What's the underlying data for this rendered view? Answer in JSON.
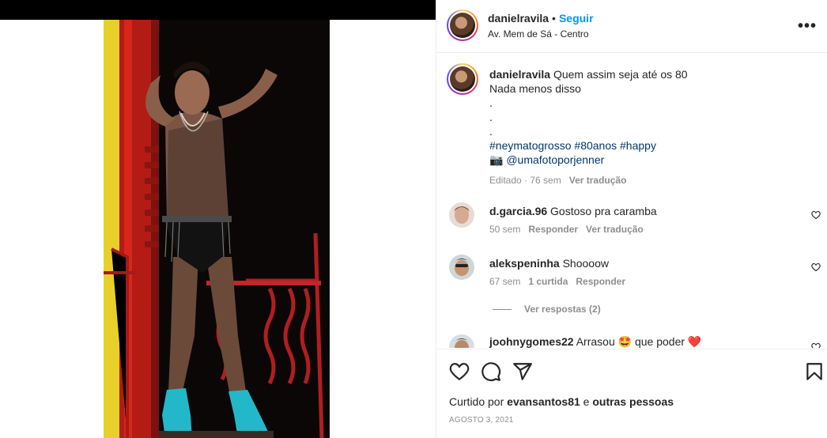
{
  "post": {
    "username": "danielravila",
    "follow_label": "Seguir",
    "location": "Av. Mem de Sá - Centro",
    "more_label": "•••"
  },
  "caption": {
    "username": "danielravila",
    "line1": "Quem assim seja até os 80",
    "line2": "Nada menos disso",
    "dot1": ".",
    "dot2": ".",
    "dot3": ".",
    "hashtags": [
      "#neymatogrosso",
      "#80anos",
      "#happy"
    ],
    "camera_emoji": "📷",
    "mention": "@umafotoporjenner",
    "edited": "Editado",
    "time": "76 sem",
    "translate": "Ver tradução"
  },
  "comments": [
    {
      "username": "d.garcia.96",
      "text": "Gostoso pra caramba",
      "time": "50 sem",
      "reply_label": "Responder",
      "translate_label": "Ver tradução"
    },
    {
      "username": "alekspeninha",
      "text": "Shoooow",
      "time": "67 sem",
      "likes_label": "1 curtida",
      "reply_label": "Responder",
      "view_replies": "Ver respostas (2)"
    },
    {
      "username": "joohnygomes22",
      "text_before": "Arrasou",
      "emoji1": "🤩",
      "text_after": "que poder",
      "emoji2": "❤️"
    }
  ],
  "footer": {
    "liked_prefix": "Curtido por",
    "liked_user": "evansantos81",
    "liked_and": "e",
    "liked_others": "outras pessoas",
    "date": "AGOSTO 3, 2021"
  },
  "icons": {
    "heart": "heart-icon",
    "comment": "comment-icon",
    "share": "share-icon",
    "save": "bookmark-icon"
  },
  "colors": {
    "accent": "#0095f6",
    "hashtag": "#00376b",
    "muted": "#8e8e8e"
  }
}
